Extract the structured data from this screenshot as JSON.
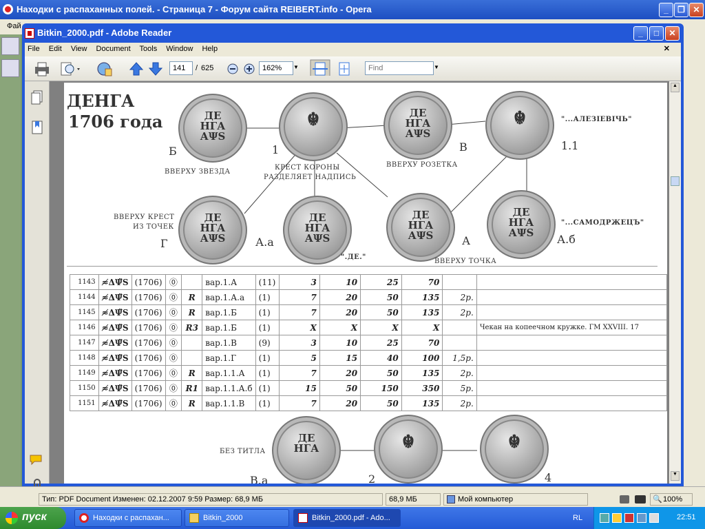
{
  "opera": {
    "title": "Находки с распаханных полей. - Страница 7 - Форум сайта REIBERT.info - Opera",
    "menu_hint": "Фай"
  },
  "reader": {
    "title": "Bitkin_2000.pdf - Adobe Reader",
    "menu": [
      "File",
      "Edit",
      "View",
      "Document",
      "Tools",
      "Window",
      "Help"
    ],
    "page_current": "141",
    "page_sep": "/",
    "page_total": "625",
    "zoom": "162%",
    "find_placeholder": "Find"
  },
  "doc": {
    "heading1": "ДЕНГА",
    "heading2": "1706 года",
    "coins": [
      {
        "text": "ДЕ\nНГА\nАΨS"
      },
      {
        "text": ""
      },
      {
        "text": "ДЕ\nНГА\nАΨS"
      },
      {
        "text": ""
      },
      {
        "text": "ДЕ\nНГА\nАΨS"
      },
      {
        "text": "ДЕ\nНГА\nАΨS"
      },
      {
        "text": "ДЕ\nНГА\nАΨS"
      },
      {
        "text": "ДЕ\nНГА\nАΨS"
      },
      {
        "text": "ДЕ\nНГА"
      },
      {
        "text": ""
      },
      {
        "text": ""
      }
    ],
    "labels": {
      "b": "Б",
      "one": "1",
      "v": "В",
      "one_one": "1.1",
      "alex": "\"...АЛЕЗIЕВIЧЬ\"",
      "top_star": "ВВЕРХУ ЗВЕЗДА",
      "cross1": "КРЕСТ КОРОНЫ",
      "cross2": "РАЗДЕЛЯЕТ НАДПИСЬ",
      "rosette": "ВВЕРХУ РОЗЕТКА",
      "dots1": "ВВЕРХУ КРЕСТ",
      "dots2": "ИЗ ТОЧЕК",
      "g": "Г",
      "aa": "А.а",
      "de": "\".ДЕ.\"",
      "a": "А",
      "top_dot": "ВВЕРХУ ТОЧКА",
      "ab": "А.б",
      "samo": "\"...САМОДРЖЕЦЪ\"",
      "no_title": "БЕЗ ТИТЛА",
      "va": "В.а",
      "two": "2",
      "four": "4"
    },
    "rows": [
      {
        "n": "1143",
        "s": "≉ΔΨ̃S",
        "y": "(1706)",
        "o": "⓪",
        "r": "",
        "var": "вар.1.А",
        "q": "(11)",
        "v": [
          "3",
          "10",
          "25",
          "70"
        ],
        "p": "",
        "note": ""
      },
      {
        "n": "1144",
        "s": "≉ΔΨ̃S",
        "y": "(1706)",
        "o": "⓪",
        "r": "R",
        "var": "вар.1.А.а",
        "q": "(1)",
        "v": [
          "7",
          "20",
          "50",
          "135"
        ],
        "p": "2р.",
        "note": ""
      },
      {
        "n": "1145",
        "s": "≉ΔΨ̃S",
        "y": "(1706)",
        "o": "⓪",
        "r": "R",
        "var": "вар.1.Б",
        "q": "(1)",
        "v": [
          "7",
          "20",
          "50",
          "135"
        ],
        "p": "2р.",
        "note": ""
      },
      {
        "n": "1146",
        "s": "≉ΔΨ̃S",
        "y": "(1706)",
        "o": "⓪",
        "r": "R3",
        "var": "вар.1.Б",
        "q": "(1)",
        "v": [
          "X",
          "X",
          "X",
          "X"
        ],
        "p": "",
        "note": "Чекан на копеечном кружке. ГМ XXVIII. 17"
      },
      {
        "n": "1147",
        "s": "≉ΔΨ̃S",
        "y": "(1706)",
        "o": "⓪",
        "r": "",
        "var": "вар.1.В",
        "q": "(9)",
        "v": [
          "3",
          "10",
          "25",
          "70"
        ],
        "p": "",
        "note": ""
      },
      {
        "n": "1148",
        "s": "≉ΔΨ̃S",
        "y": "(1706)",
        "o": "⓪",
        "r": "",
        "var": "вар.1.Г",
        "q": "(1)",
        "v": [
          "5",
          "15",
          "40",
          "100"
        ],
        "p": "1,5р.",
        "note": ""
      },
      {
        "n": "1149",
        "s": "≉ΔΨ̃S",
        "y": "(1706)",
        "o": "⓪",
        "r": "R",
        "var": "вар.1.1.А",
        "q": "(1)",
        "v": [
          "7",
          "20",
          "50",
          "135"
        ],
        "p": "2р.",
        "note": ""
      },
      {
        "n": "1150",
        "s": "≉ΔΨ̃S",
        "y": "(1706)",
        "o": "⓪",
        "r": "R1",
        "var": "вар.1.1.А.б",
        "q": "(1)",
        "v": [
          "15",
          "50",
          "150",
          "350"
        ],
        "p": "5р.",
        "note": ""
      },
      {
        "n": "1151",
        "s": "≉ΔΨ̃S",
        "y": "(1706)",
        "o": "⓪",
        "r": "R",
        "var": "вар.1.1.В",
        "q": "(1)",
        "v": [
          "7",
          "20",
          "50",
          "135"
        ],
        "p": "2р.",
        "note": ""
      }
    ]
  },
  "status": {
    "info": "Тип: PDF Document Изменен: 02.12.2007 9:59 Размер: 68,9 МБ",
    "size": "68,9 МБ",
    "computer": "Мой компьютер",
    "zoom": "100%"
  },
  "taskbar": {
    "start": "пуск",
    "tasks": [
      "Находки с распахан...",
      "Bitkin_2000",
      "Bitkin_2000.pdf - Ado..."
    ],
    "lang": "RL",
    "clock": "22:51"
  },
  "colors": {
    "xp_blue": "#2358d8",
    "xp_green": "#2e8a2e",
    "chrome": "#ece9d8"
  }
}
